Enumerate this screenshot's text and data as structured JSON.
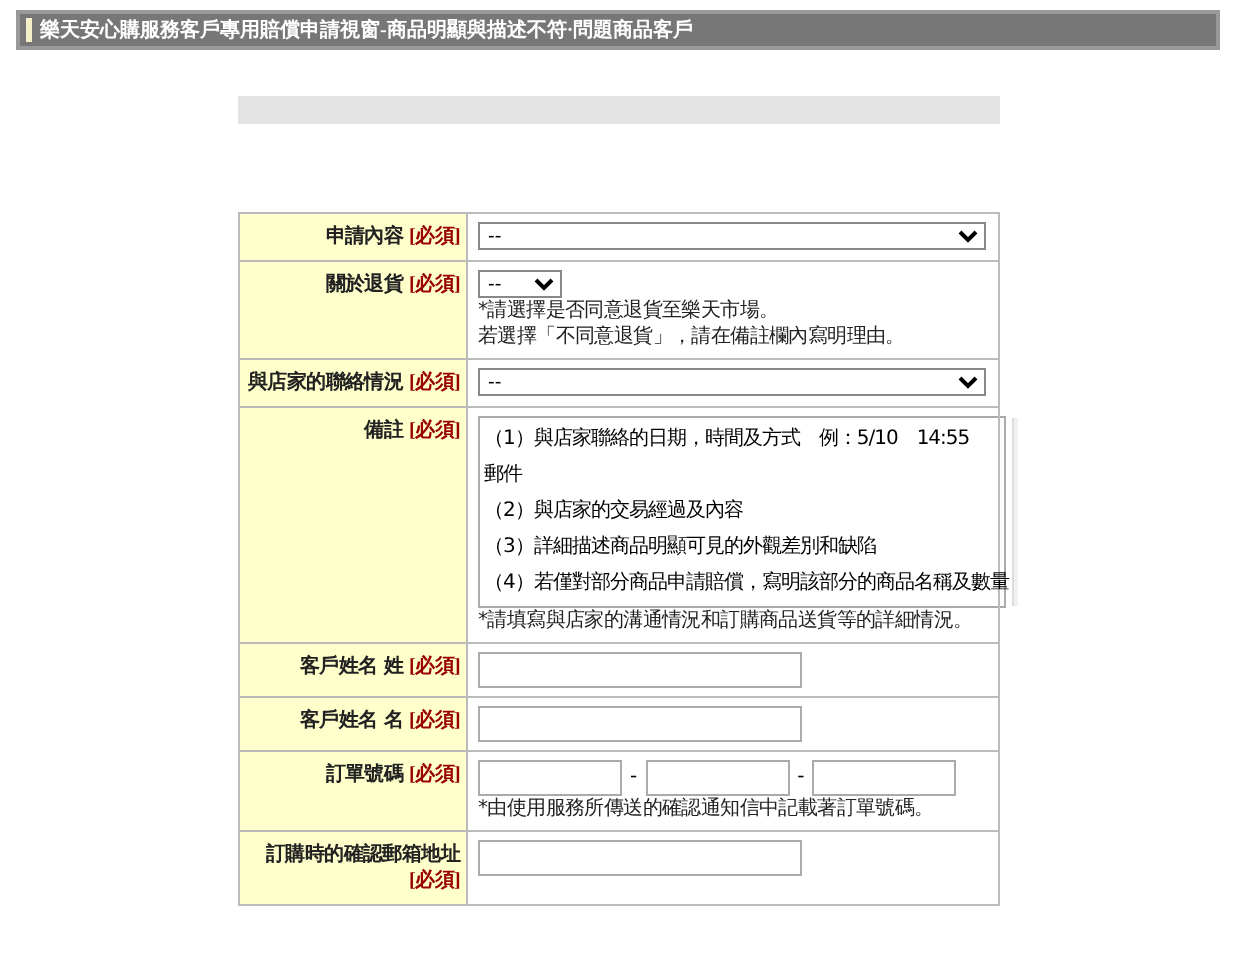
{
  "window": {
    "title": "樂天安心購服務客戶專用賠償申請視窗-商品明顯與描述不符·問題商品客戶"
  },
  "form": {
    "rows": [
      {
        "kind": "dropdown",
        "label": "申請內容",
        "required": "[必須]",
        "value": "--",
        "notes": []
      },
      {
        "kind": "short-dropdown",
        "label": "關於退貨",
        "required": "[必須]",
        "value": "--",
        "notes": [
          "*請選擇是否同意退貨至樂天市場。",
          "若選擇「不同意退貨」，請在備註欄內寫明理由。"
        ]
      },
      {
        "kind": "dropdown",
        "label": "與店家的聯絡情況",
        "required": "[必須]",
        "value": "--",
        "notes": []
      },
      {
        "kind": "textarea",
        "label": "備註",
        "required": "[必須]",
        "lines": [
          "（1）與店家聯絡的日期，時間及方式　例：5/10　14:55",
          "郵件",
          "（2）與店家的交易經過及內容",
          "（3）詳細描述商品明顯可見的外觀差別和缺陷",
          "（4）若僅對部分商品申請賠償，寫明該部分的商品名稱及數量"
        ],
        "notes": [
          "*請填寫與店家的溝通情況和訂購商品送貨等的詳細情況。"
        ]
      },
      {
        "kind": "text",
        "label": "客戶姓名 姓",
        "required": "[必須]",
        "value": "",
        "notes": []
      },
      {
        "kind": "text",
        "label": "客戶姓名 名",
        "required": "[必須]",
        "value": "",
        "notes": []
      },
      {
        "kind": "order-number",
        "label": "訂單號碼",
        "required": "[必須]",
        "separator": "-",
        "notes": [
          "*由使用服務所傳送的確認通知信中記載著訂單號碼。"
        ]
      },
      {
        "kind": "text",
        "label": "訂購時的確認郵箱地址",
        "required": "[必須]",
        "value": "",
        "notes": []
      }
    ]
  }
}
